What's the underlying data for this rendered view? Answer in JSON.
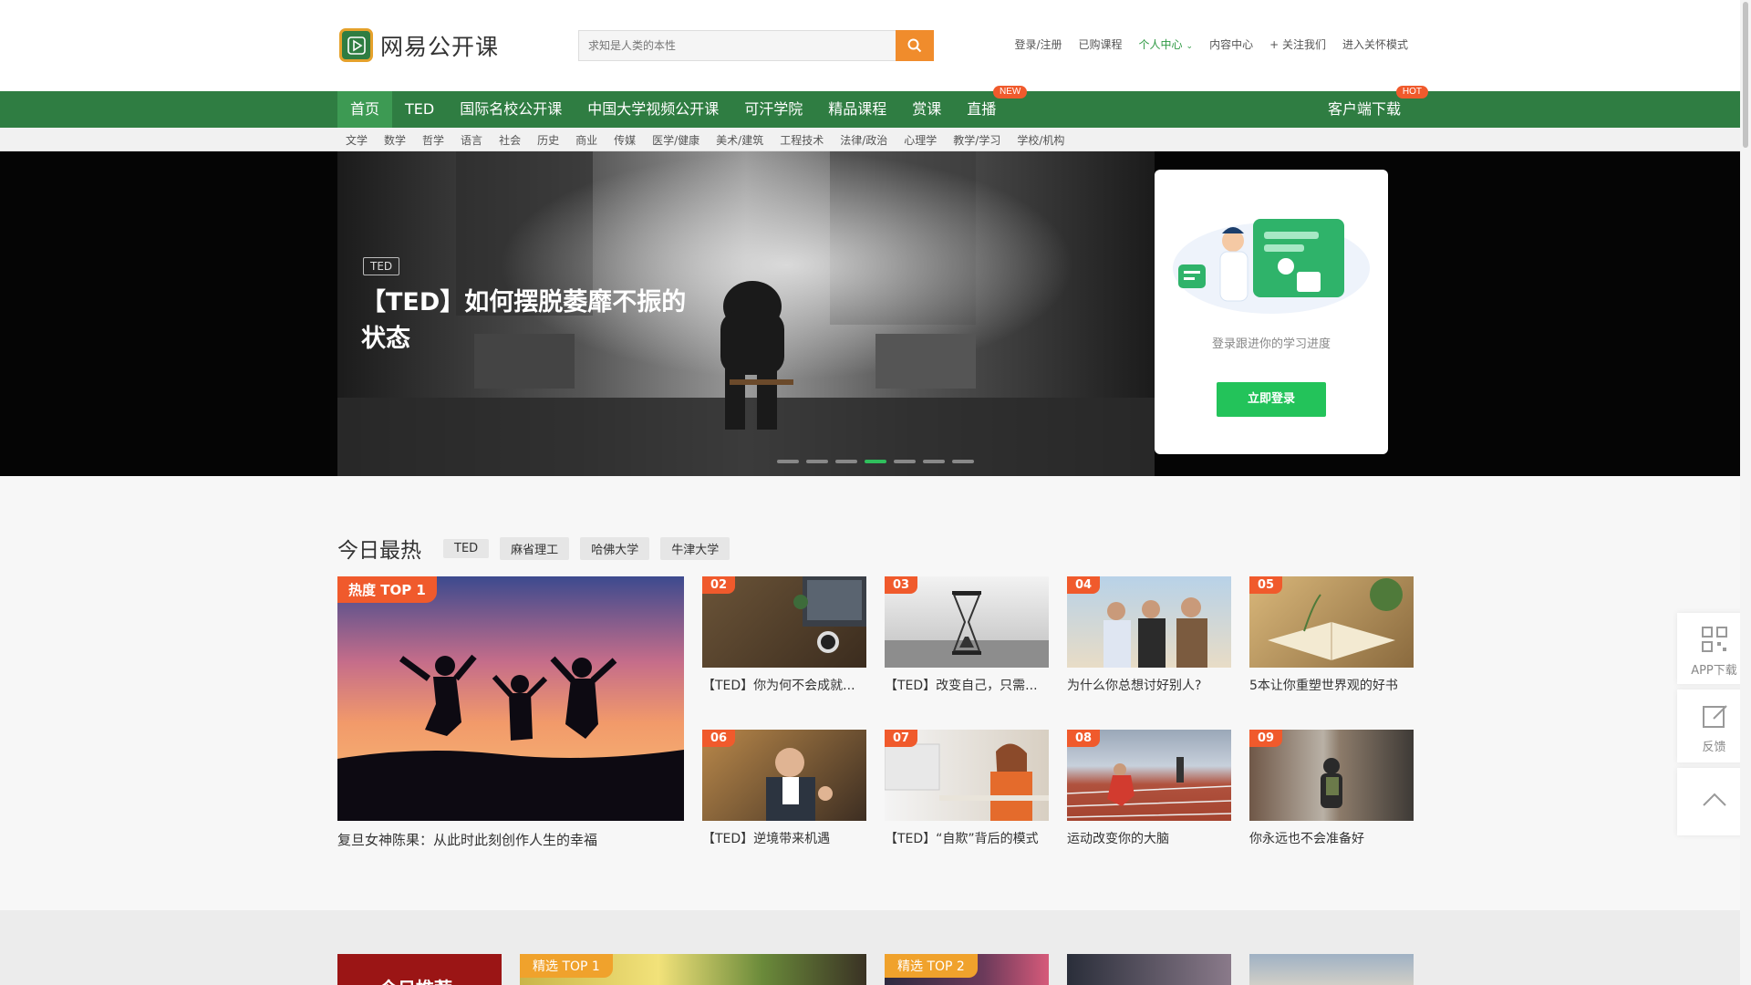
{
  "header": {
    "logo_text": "网易公开课",
    "search_placeholder": "求知是人类的本性",
    "links": {
      "login": "登录/注册",
      "purchased": "已购课程",
      "personal_center": "个人中心",
      "content_center": "内容中心",
      "follow": "+ 关注我们",
      "care_mode": "进入关怀模式"
    }
  },
  "nav": {
    "items": [
      "首页",
      "TED",
      "国际名校公开课",
      "中国大学视频公开课",
      "可汗学院",
      "精品课程",
      "赏课",
      "直播"
    ],
    "live_badge": "NEW",
    "download": "客户端下载",
    "download_badge": "HOT"
  },
  "subnav": [
    "文学",
    "数学",
    "哲学",
    "语言",
    "社会",
    "历史",
    "商业",
    "传媒",
    "医学/健康",
    "美术/建筑",
    "工程技术",
    "法律/政治",
    "心理学",
    "教学/学习",
    "学校/机构"
  ],
  "banner": {
    "tag": "TED",
    "title": "【TED】如何摆脱萎靡不振的状态",
    "dots": 7,
    "active_dot": 3
  },
  "login_card": {
    "text": "登录跟进你的学习进度",
    "button": "立即登录"
  },
  "hot": {
    "title": "今日最热",
    "tags": [
      "TED",
      "麻省理工",
      "哈佛大学",
      "牛津大学"
    ],
    "top_badge": "热度 TOP 1",
    "top_caption": "复旦女神陈果：从此时此刻创作人生的幸福",
    "cards": [
      {
        "num": "02",
        "caption": "【TED】你为何不会成就..."
      },
      {
        "num": "03",
        "caption": "【TED】改变自己，只需..."
      },
      {
        "num": "04",
        "caption": "为什么你总想讨好别人?"
      },
      {
        "num": "05",
        "caption": "5本让你重塑世界观的好书"
      },
      {
        "num": "06",
        "caption": "【TED】逆境带来机遇"
      },
      {
        "num": "07",
        "caption": "【TED】“自欺”背后的模式"
      },
      {
        "num": "08",
        "caption": "运动改变你的大脑"
      },
      {
        "num": "09",
        "caption": "你永远也不会准备好"
      }
    ]
  },
  "bottom": {
    "badges": [
      "精选 TOP 1",
      "精选 TOP 2"
    ],
    "red_tile_text": "今日推荐"
  },
  "side": {
    "app": "APP下载",
    "feedback": "反馈"
  },
  "colors": {
    "nav_green": "#2f7d42",
    "accent_orange": "#f08c2c",
    "badge_red": "#f05a2c",
    "login_green": "#23c35a"
  }
}
